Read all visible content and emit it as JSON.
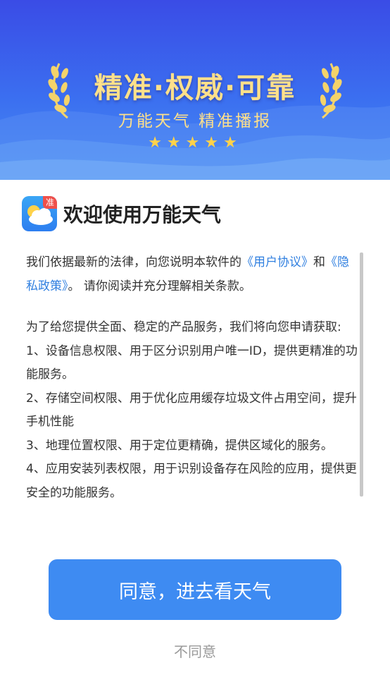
{
  "banner": {
    "slogan": "精准·权威·可靠",
    "subtitle": "万能天气   精准播报",
    "stars": "★★★★★",
    "colors": {
      "gold": "#ffe08a",
      "star": "#ffd24a"
    }
  },
  "dialog": {
    "app_badge": "准",
    "title": "欢迎使用万能天气",
    "p1_text1": "我们依据最新的法律，向您说明本软件的",
    "p1_link1": "《用户协议》",
    "p1_text2": "和",
    "p1_link2": "《隐私政策》",
    "p1_text3": "。 请你阅读并充分理解相关条款。",
    "p2_intro": "为了给您提供全面、稳定的产品服务，我们将向您申请获取:",
    "items": [
      "1、设备信息权限、用于区分识别用户唯一ID，提供更精准的功能服务。",
      "2、存储空间权限、用于优化应用缓存垃圾文件占用空间，提升手机性能",
      "3、地理位置权限、用于定位更精确，提供区域化的服务。",
      "4、应用安装列表权限，用于识别设备存在风险的应用，提供更安全的功能服务。"
    ],
    "colors": {
      "link": "#2f7fe0",
      "button": "#3e8bf2"
    }
  },
  "actions": {
    "agree_label": "同意，进去看天气",
    "disagree_label": "不同意"
  }
}
